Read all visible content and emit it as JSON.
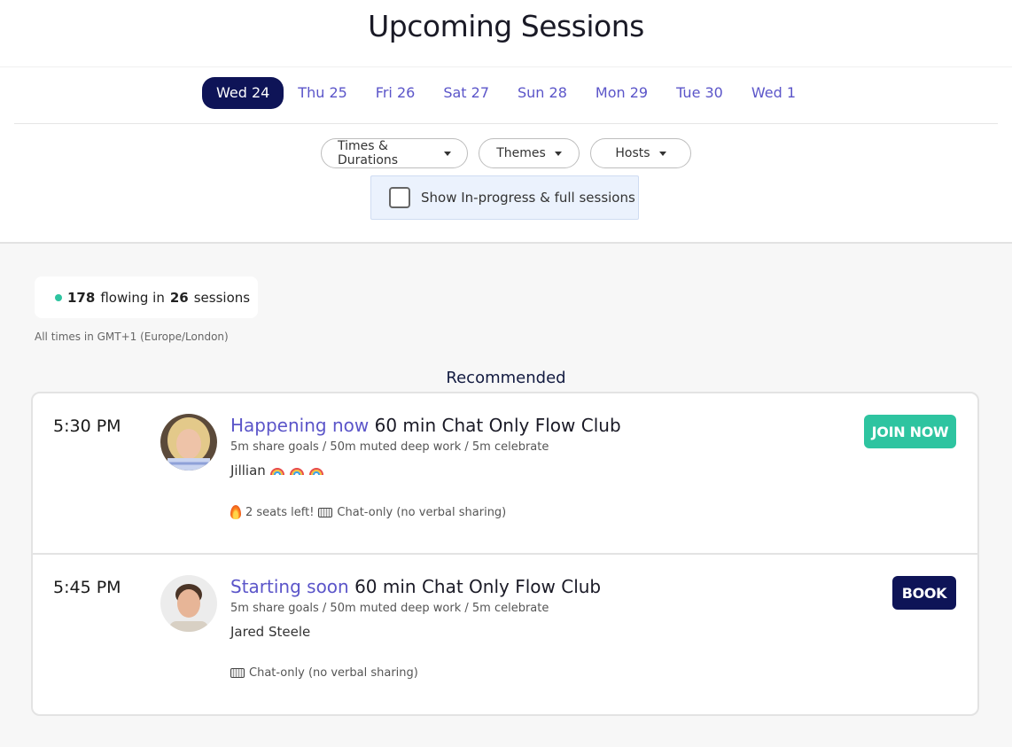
{
  "header": {
    "title": "Upcoming Sessions"
  },
  "dates": [
    {
      "label": "Wed 24",
      "active": true
    },
    {
      "label": "Thu 25"
    },
    {
      "label": "Fri 26"
    },
    {
      "label": "Sat 27"
    },
    {
      "label": "Sun 28"
    },
    {
      "label": "Mon 29"
    },
    {
      "label": "Tue 30"
    },
    {
      "label": "Wed 1"
    }
  ],
  "filters": {
    "times": "Times & Durations",
    "themes": "Themes",
    "hosts": "Hosts",
    "show_in_progress": "Show In-progress & full sessions",
    "show_in_progress_checked": false
  },
  "stats": {
    "flowing": "178",
    "flowing_text": "flowing in",
    "sessions": "26",
    "sessions_text": "sessions"
  },
  "timezone_note": "All times in GMT+1 (Europe/London)",
  "recommended_heading": "Recommended",
  "sessions": [
    {
      "time": "5:30 PM",
      "status": "Happening now",
      "title": "60 min Chat Only Flow Club",
      "agenda": "5m share goals / 50m muted deep work / 5m celebrate",
      "host": "Jillian",
      "host_icons": [
        "rainbow-icon",
        "rainbow-icon",
        "rainbow-icon"
      ],
      "seats": "2 seats left!",
      "mode": "Chat-only (no verbal sharing)",
      "action": "JOIN NOW"
    },
    {
      "time": "5:45 PM",
      "status": "Starting soon",
      "title": "60 min Chat Only Flow Club",
      "agenda": "5m share goals / 50m muted deep work / 5m celebrate",
      "host": "Jared Steele",
      "mode": "Chat-only (no verbal sharing)",
      "action": "BOOK"
    }
  ],
  "colors": {
    "accent": "#5b55c9",
    "navy": "#0e1457",
    "teal": "#2ec4a0"
  }
}
